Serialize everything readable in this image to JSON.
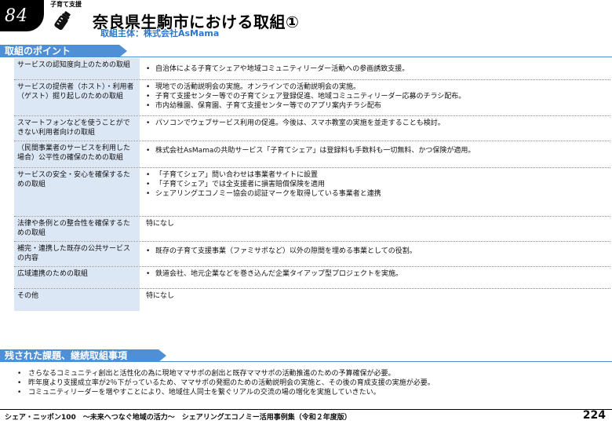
{
  "header": {
    "number": "84",
    "category": "子育て支援",
    "title": "奈良県生駒市における取組①",
    "subtitle": "取組主体：株式会社AsMama"
  },
  "section1": {
    "label": "取組のポイント"
  },
  "rows": [
    {
      "head": "サービスの認知度向上のための取組",
      "items": [
        "自治体による子育てシェアや地域コミュニティリーダー活動への参画誘致支援。"
      ]
    },
    {
      "head": "サービスの提供者（ホスト）・利用者（ゲスト）掘り起しのための取組",
      "items": [
        "現地での活動説明会の実施。オンラインでの活動説明会の実施。",
        "子育て支援センター等での子育てシェア登録促進、地域コミュニティリーダー応募のチラシ配布。",
        "市内幼稚園、保育園、子育て支援センター等でのアプリ案内チラシ配布"
      ]
    },
    {
      "head": "スマートフォンなどを使うことができない利用者向けの取組",
      "items": [
        "パソコンでウェブサービス利用の促進。今後は、スマホ教室の実施を並走することも検討。"
      ]
    },
    {
      "head": "（民間事業者のサービスを利用した場合）公平性の確保のための取組",
      "items": [
        "株式会社AsMamaの共助サービス「子育てシェア」は登録料も手数料も一切無料、かつ保険が適用。"
      ]
    },
    {
      "head": "サービスの安全・安心を確保するための取組",
      "items": [
        "「子育てシェア」問い合わせは事業者サイトに設置",
        "「子育てシェア」では全支援者に損害賠償保険を適用",
        "シェアリングエコノミー協会の認証マークを取得している事業者と連携"
      ]
    },
    {
      "head": "法律や条例との整合性を確保するための取組",
      "text": "特になし"
    },
    {
      "head": "補完・連携した既存の公共サービスの内容",
      "items": [
        "既存の子育て支援事業（ファミサポなど）以外の隙間を埋める事業としての役割。"
      ]
    },
    {
      "head": "広域連携のための取組",
      "items": [
        "鉄道会社、地元企業などを巻き込んだ企業タイアップ型プロジェクトを実施。"
      ]
    },
    {
      "head": "その他",
      "text": "特になし"
    }
  ],
  "section2": {
    "label": "残された課題、継続取組事項"
  },
  "issues": [
    "さらなるコミュニティ創出と活性化の為に現地ママサポの創出と既存ママサポの活動推進のための予算確保が必要。",
    "昨年度より支援成立率が2％下がっているため、ママサポの発掘のための活動説明会の実施と、その後の育成支援の実施が必要。",
    "コミュニティリーダーを増やすことにより、地域住人同士を繋ぐリアルの交流の場の増化を実施していきたい。"
  ],
  "footer": {
    "text": "シェア・ニッポン100　～未来へつなぐ地域の活力～　シェアリングエコノミー活用事例集（令和２年度版）",
    "page": "224"
  },
  "colors": {
    "accent": "#4f8fd6",
    "subtitle": "#2e77c7",
    "cell": "#dce7f6"
  },
  "icons": {
    "category": "baby-bottle-icon"
  }
}
